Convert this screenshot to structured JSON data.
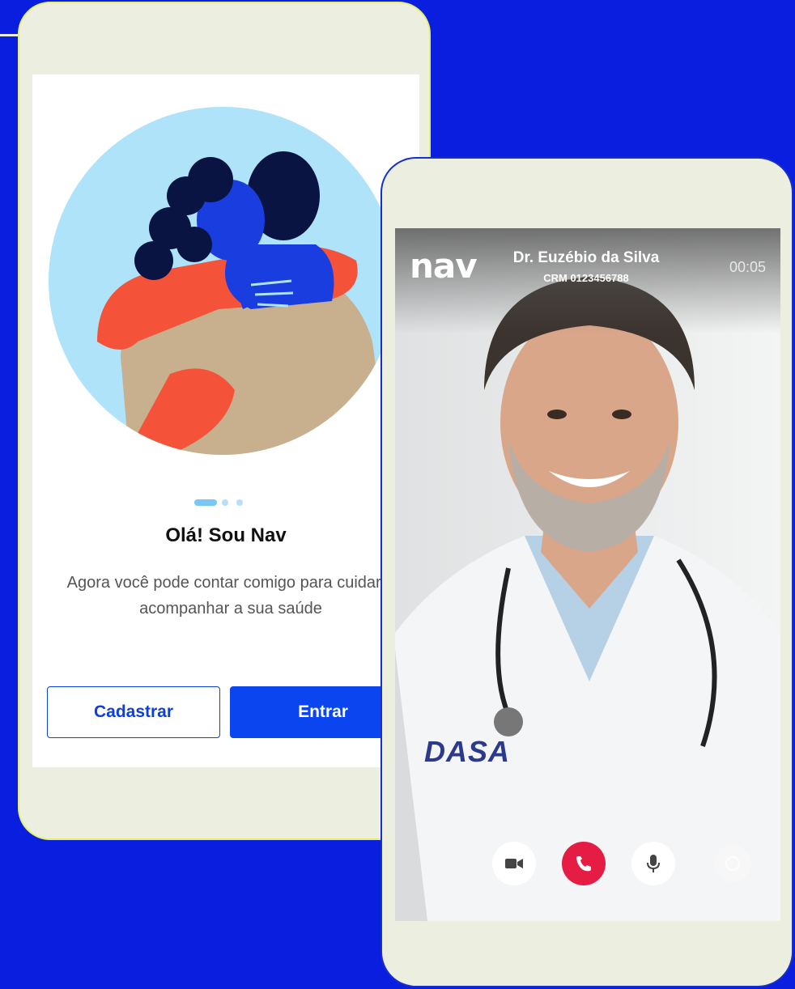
{
  "colors": {
    "background": "#0a1ee0",
    "primary_button": "#0a45f0",
    "end_call": "#e51c44",
    "phone_frame": "#eceee0"
  },
  "onboarding": {
    "pagination": {
      "total": 3,
      "active": 1
    },
    "title": "Olá! Sou Nav",
    "body": "Agora você pode contar comigo para cuidar e acompanhar a sua saúde",
    "register_label": "Cadastrar",
    "login_label": "Entrar"
  },
  "call": {
    "app_logo": "nav",
    "doctor_name": "Dr. Euzébio da Silva",
    "doctor_crm": "CRM 0123456788",
    "elapsed": "00:05",
    "coat_logo": "DASA",
    "controls": [
      {
        "icon": "video-camera-icon"
      },
      {
        "icon": "end-call-icon"
      },
      {
        "icon": "microphone-icon"
      },
      {
        "icon": "switch-camera-icon"
      }
    ]
  }
}
